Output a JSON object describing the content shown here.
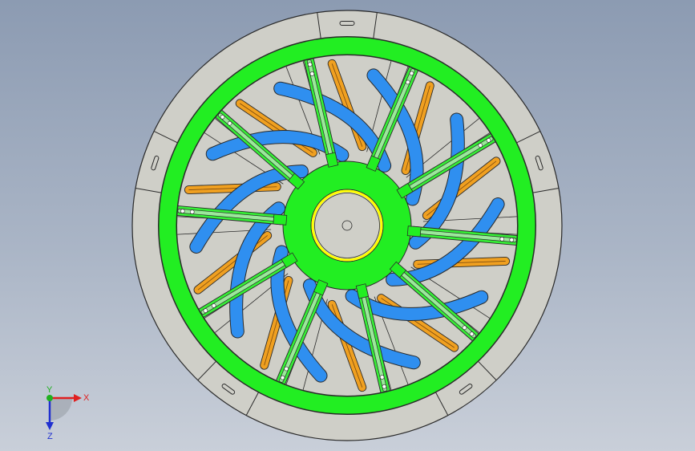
{
  "viewport": {
    "background_top": "#8c9bb2",
    "background_bottom": "#c9cfd9"
  },
  "model": {
    "spoke_count": 10,
    "colors": {
      "outer_disk": "#cfcfc8",
      "outline": "#2a2a2a",
      "rim_ring": "#22ee22",
      "hub": "#22ee22",
      "spokes": "#36ee36",
      "blades": "#2f8ff0",
      "slots": "#f0a020",
      "bore_ring": "#ffff00"
    }
  },
  "triad": {
    "x_label": "X",
    "y_label": "Y",
    "z_label": "Z",
    "x_color": "#e02020",
    "y_color": "#20b020",
    "z_color": "#2030d0"
  }
}
